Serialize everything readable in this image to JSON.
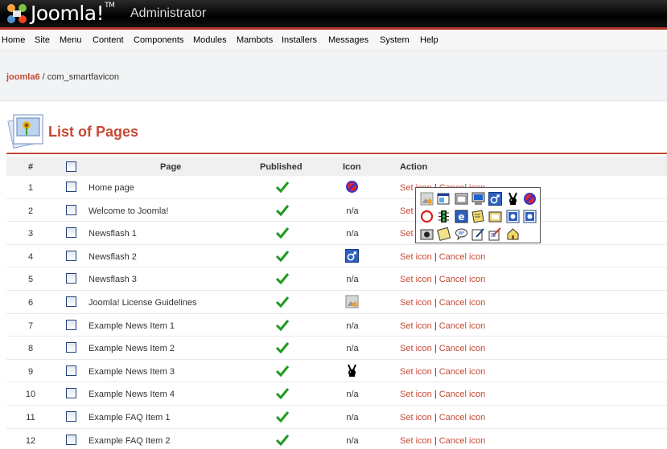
{
  "header": {
    "logo_text": "Joomla!",
    "logo_tm": "TM",
    "admin_label": "Administrator"
  },
  "menu": [
    "Home",
    "Site",
    "Menu",
    "Content",
    "Components",
    "Modules",
    "Mambots",
    "Installers",
    "Messages",
    "System",
    "Help"
  ],
  "pathway": {
    "link": "joomla6",
    "separator": " / ",
    "current": "com_smartfavicon"
  },
  "page_title": "List of Pages",
  "table": {
    "headers": {
      "num": "#",
      "page": "Page",
      "published": "Published",
      "icon": "Icon",
      "action": "Action"
    },
    "rows": [
      {
        "num": "1",
        "page": "Home page",
        "icon": "no-entry-icon",
        "icon_text": ""
      },
      {
        "num": "2",
        "page": "Welcome to Joomla!",
        "icon": "",
        "icon_text": "n/a"
      },
      {
        "num": "3",
        "page": "Newsflash 1",
        "icon": "",
        "icon_text": "n/a"
      },
      {
        "num": "4",
        "page": "Newsflash 2",
        "icon": "male-symbol-icon",
        "icon_text": ""
      },
      {
        "num": "5",
        "page": "Newsflash 3",
        "icon": "",
        "icon_text": "n/a"
      },
      {
        "num": "6",
        "page": "Joomla! License Guidelines",
        "icon": "image-file-icon",
        "icon_text": ""
      },
      {
        "num": "7",
        "page": "Example News Item 1",
        "icon": "",
        "icon_text": "n/a"
      },
      {
        "num": "8",
        "page": "Example News Item 2",
        "icon": "",
        "icon_text": "n/a"
      },
      {
        "num": "9",
        "page": "Example News Item 3",
        "icon": "bunny-icon",
        "icon_text": ""
      },
      {
        "num": "10",
        "page": "Example News Item 4",
        "icon": "",
        "icon_text": "n/a"
      },
      {
        "num": "11",
        "page": "Example FAQ Item 1",
        "icon": "",
        "icon_text": "n/a"
      },
      {
        "num": "12",
        "page": "Example FAQ Item 2",
        "icon": "",
        "icon_text": "n/a"
      }
    ],
    "set_icon_label": "Set icon",
    "cancel_icon_label": "Cancel icon",
    "action_separator": "|"
  },
  "icon_picker": [
    "image-file-icon",
    "window-icon",
    "app-window-icon",
    "computer-icon",
    "male-symbol-icon",
    "bunny-icon",
    "no-entry-icon",
    "red-circle-icon",
    "traffic-light-icon",
    "ie-icon",
    "notes-icon",
    "folder-icon",
    "network-drive-icon",
    "network-drive-2-icon",
    "camera-icon",
    "notepad-icon",
    "speech-bubble-icon",
    "edit-icon",
    "write-icon",
    "house-icon"
  ],
  "colors": {
    "accent": "#c64934",
    "header_bg": "#000000",
    "check_green": "#1f9b1f"
  }
}
